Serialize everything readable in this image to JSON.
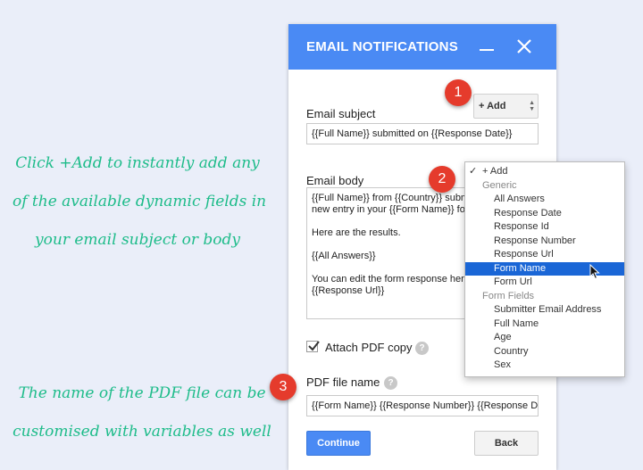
{
  "annotations": {
    "top": [
      "Click +Add to instantly add any",
      "of the available dynamic fields in",
      "your email subject or body"
    ],
    "bottom": [
      "The name of the PDF file can be",
      "customised with variables as well"
    ]
  },
  "badges": [
    "1",
    "2",
    "3"
  ],
  "panel": {
    "title": "EMAIL NOTIFICATIONS",
    "subject_label": "Email subject",
    "subject_value": "{{Full Name}} submitted on  {{Response Date}}",
    "add_label": "+ Add",
    "body_label": "Email body",
    "body_lines": [
      "{{Full Name}} from {{Country}} submitted a",
      "new entry in your {{Form Name}} form.",
      "",
      "Here are the results.",
      "",
      "{{All Answers}}",
      "",
      "You can edit the form response here:",
      "{{Response Url}}"
    ],
    "attach_label": "Attach PDF copy",
    "attach_checked": true,
    "help_glyph": "?",
    "pdf_label": "PDF file name",
    "pdf_value": "{{Form Name}} {{Response Number}} {{Response Date}}",
    "continue_label": "Continue",
    "back_label": "Back"
  },
  "dropdown": {
    "check_glyph": "✓",
    "items": [
      {
        "label": "+ Add",
        "type": "current"
      },
      {
        "label": "Generic",
        "type": "group"
      },
      {
        "label": "All Answers",
        "type": "option"
      },
      {
        "label": "Response Date",
        "type": "option"
      },
      {
        "label": "Response Id",
        "type": "option"
      },
      {
        "label": "Response Number",
        "type": "option"
      },
      {
        "label": "Response Url",
        "type": "option"
      },
      {
        "label": "Form Name",
        "type": "option",
        "selected": true
      },
      {
        "label": "Form Url",
        "type": "option"
      },
      {
        "label": "Form Fields",
        "type": "group"
      },
      {
        "label": "Submitter Email Address",
        "type": "option"
      },
      {
        "label": "Full Name",
        "type": "option"
      },
      {
        "label": "Age",
        "type": "option"
      },
      {
        "label": "Country",
        "type": "option"
      },
      {
        "label": "Sex",
        "type": "option"
      }
    ]
  },
  "colors": {
    "header": "#4a8af4",
    "annotation": "#1ebc8a",
    "badge": "#e53b2c",
    "selected": "#1a66d6"
  }
}
